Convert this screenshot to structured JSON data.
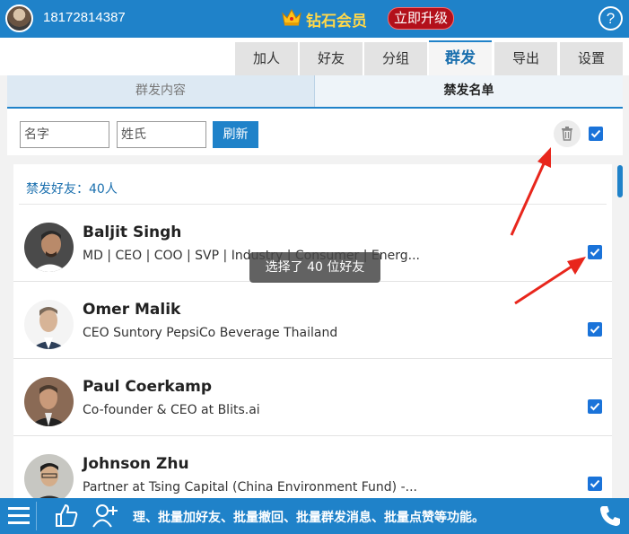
{
  "header": {
    "phone": "18172814387",
    "vip_label": "钻石会员",
    "upgrade_label": "立即升级",
    "help_label": "?"
  },
  "main_tabs": [
    {
      "label": "加人"
    },
    {
      "label": "好友"
    },
    {
      "label": "分组"
    },
    {
      "label": "群发",
      "active": true
    },
    {
      "label": "导出"
    },
    {
      "label": "设置"
    }
  ],
  "sub_tabs": [
    {
      "label": "群发内容"
    },
    {
      "label": "禁发名单",
      "active": true
    }
  ],
  "filter": {
    "name_placeholder": "名字",
    "surname_placeholder": "姓氏",
    "refresh_label": "刷新",
    "select_all_checked": true
  },
  "list": {
    "count_label": "禁发好友：40人",
    "items": [
      {
        "name": "Baljit Singh",
        "desc": "MD | CEO | COO | SVP | Industry | Consumer | Energ...",
        "checked": true
      },
      {
        "name": "Omer Malik",
        "desc": "CEO Suntory PepsiCo Beverage Thailand",
        "checked": true
      },
      {
        "name": "Paul Coerkamp",
        "desc": "Co-founder & CEO at Blits.ai",
        "checked": true
      },
      {
        "name": "Johnson Zhu",
        "desc": "Partner at Tsing Capital (China Environment Fund) -...",
        "checked": true
      }
    ]
  },
  "toast": "选择了 40 位好友",
  "footer": {
    "marquee": "理、批量加好友、批量撤回、批量群发消息、批量点赞等功能。"
  },
  "colors": {
    "brand_blue": "#1f82c9",
    "checkbox_blue": "#1a73d9",
    "upgrade_red": "#b3101b",
    "vip_gold": "#ffd84a",
    "annotation_red": "#e8261c"
  },
  "icons": {
    "menu": "menu-icon",
    "like": "thumbs-up-icon",
    "add_friend": "add-person-icon",
    "phone": "phone-icon",
    "trash": "trash-icon",
    "crown": "crown-icon"
  }
}
